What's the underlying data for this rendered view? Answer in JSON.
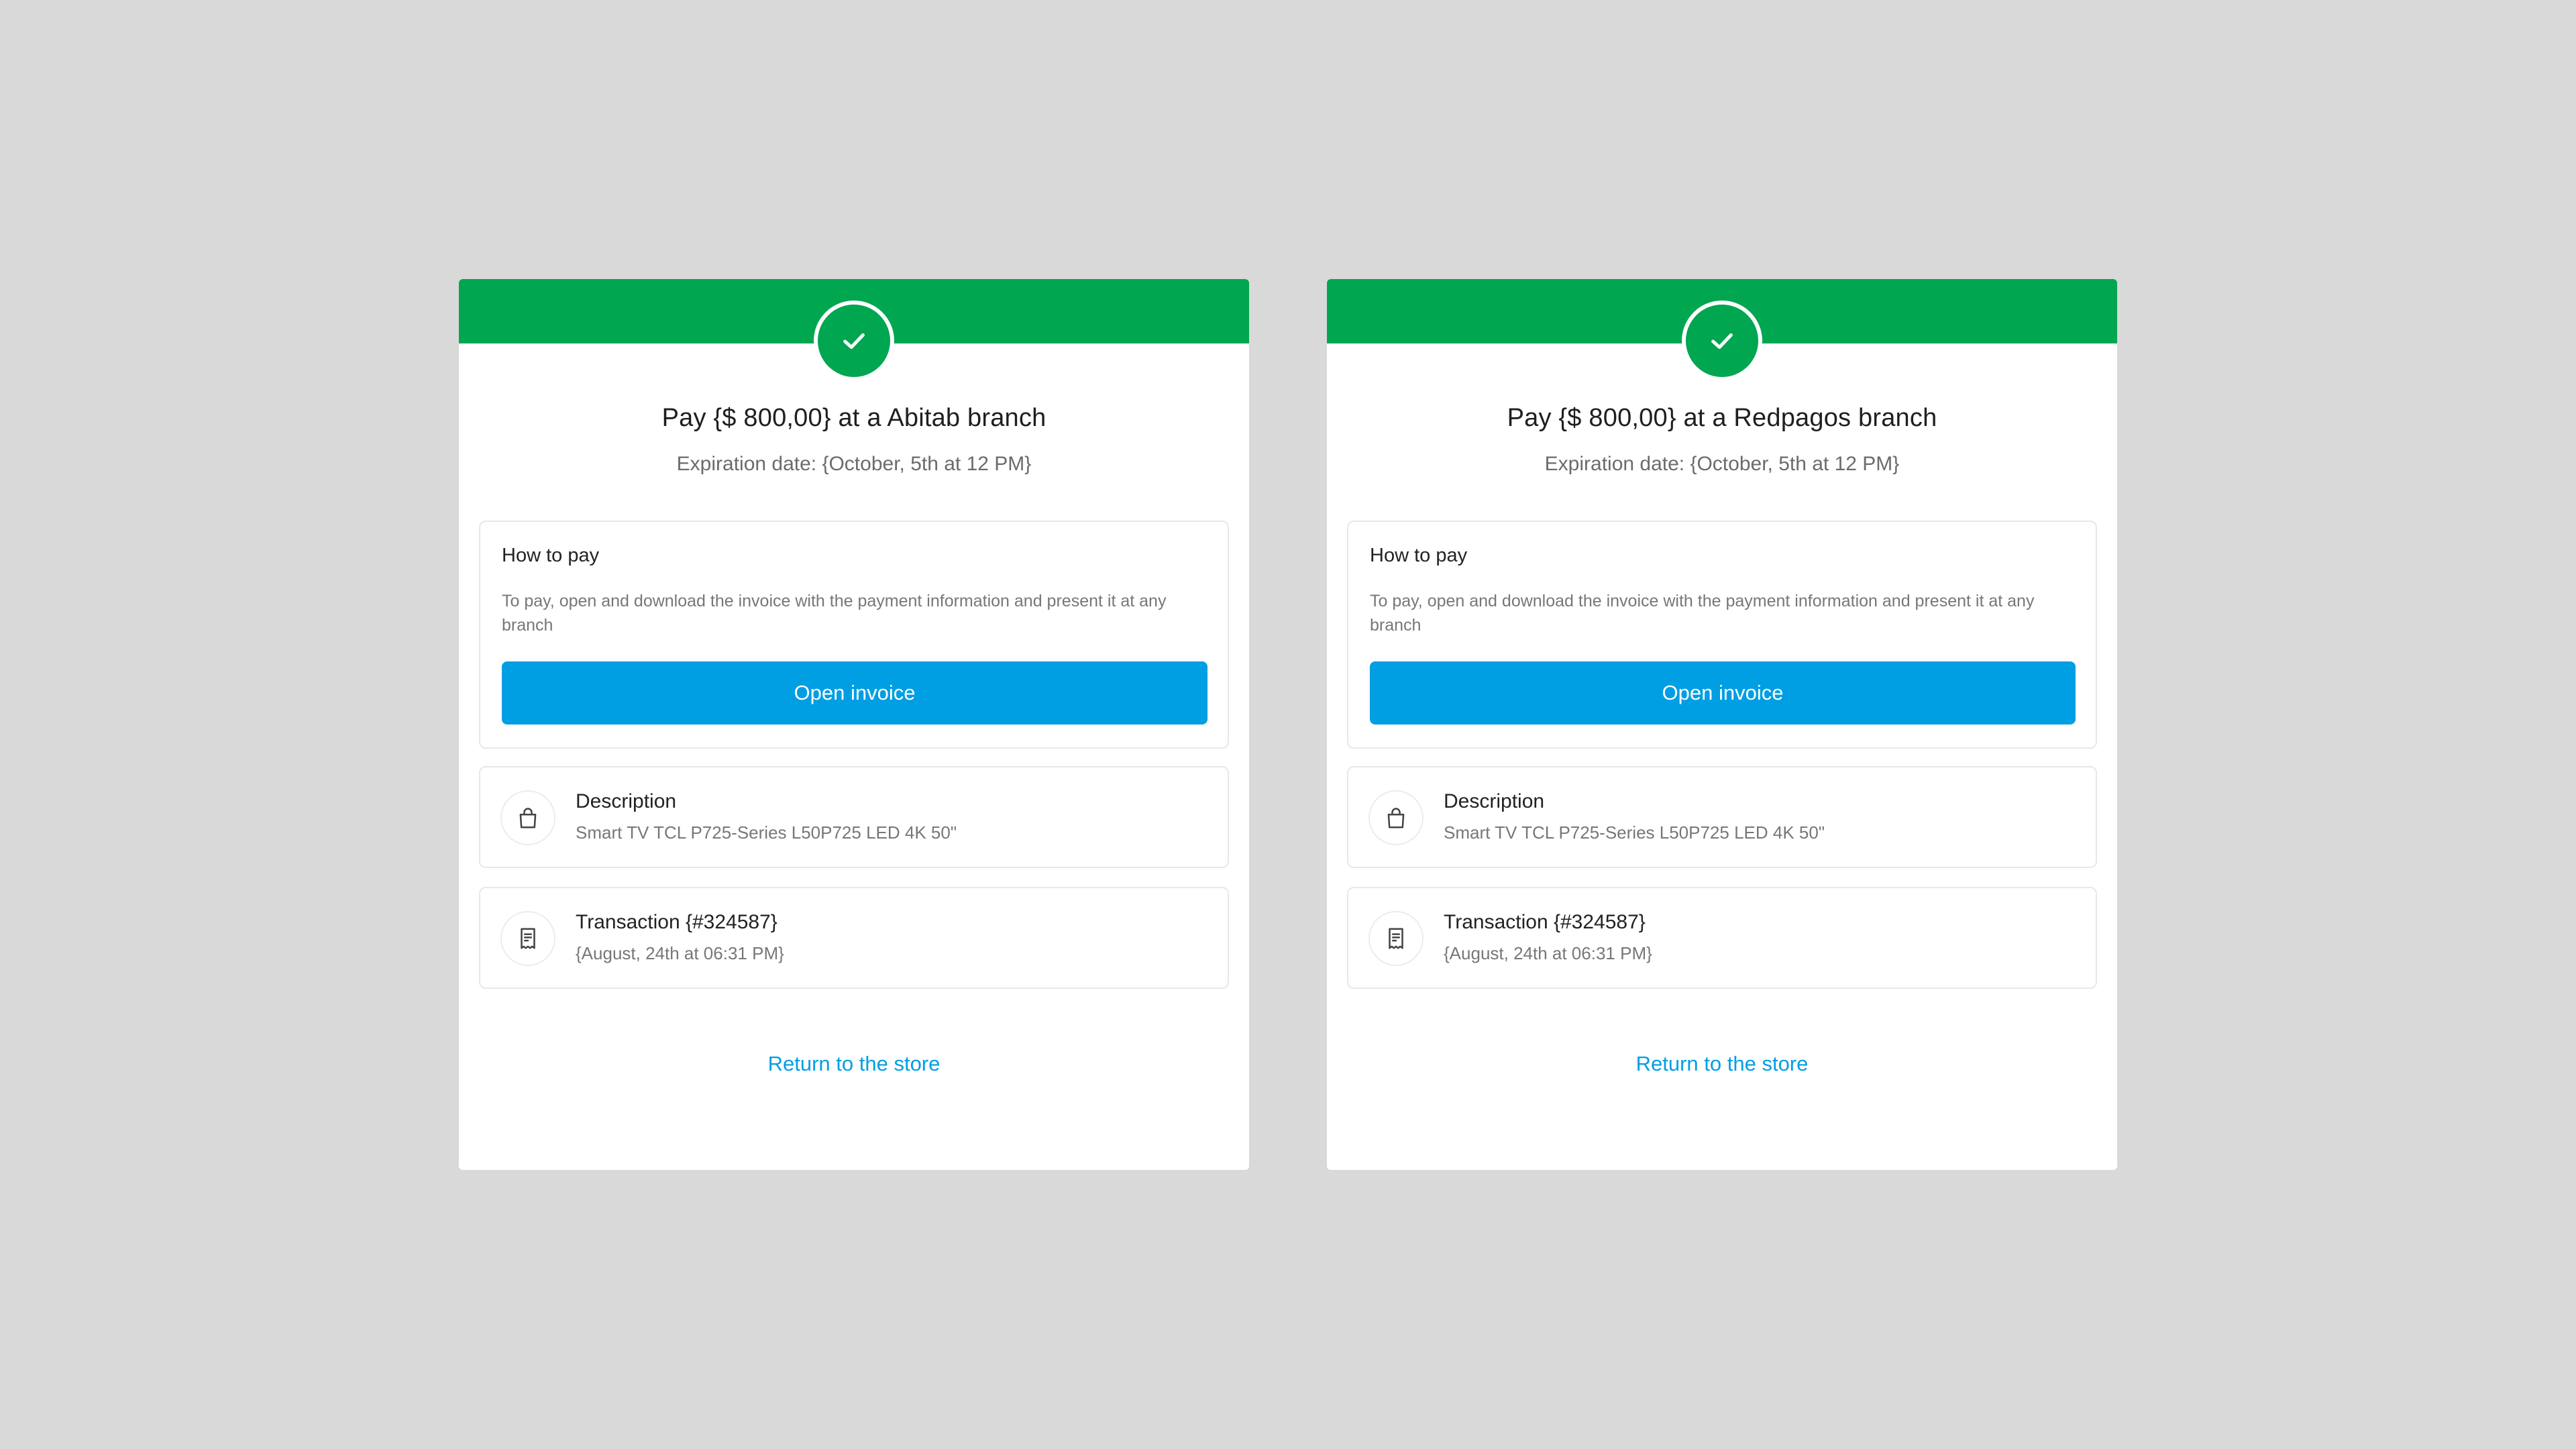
{
  "colors": {
    "background": "#d9d9d9",
    "header_green": "#00a650",
    "primary_blue": "#009ee3"
  },
  "cards": [
    {
      "title": "Pay {$ 800,00} at a Abitab branch",
      "expiration": "Expiration date: {October, 5th at 12 PM}",
      "how_to_pay": {
        "title": "How to pay",
        "text": "To pay, open and download the invoice with the payment information and present it at any branch",
        "button_label": "Open invoice"
      },
      "description": {
        "icon": "shopping-bag-icon",
        "title": "Description",
        "value": "Smart TV TCL P725-Series L50P725 LED 4K 50\""
      },
      "transaction": {
        "icon": "receipt-icon",
        "title": "Transaction {#324587}",
        "value": "{August, 24th at 06:31 PM}"
      },
      "return_link": "Return to the store"
    },
    {
      "title": "Pay {$ 800,00} at a Redpagos branch",
      "expiration": "Expiration date: {October, 5th at 12 PM}",
      "how_to_pay": {
        "title": "How to pay",
        "text": "To pay, open and download the invoice with the payment information and present it at any branch",
        "button_label": "Open invoice"
      },
      "description": {
        "icon": "shopping-bag-icon",
        "title": "Description",
        "value": "Smart TV TCL P725-Series L50P725 LED 4K 50\""
      },
      "transaction": {
        "icon": "receipt-icon",
        "title": "Transaction {#324587}",
        "value": "{August, 24th at 06:31 PM}"
      },
      "return_link": "Return to the store"
    }
  ]
}
